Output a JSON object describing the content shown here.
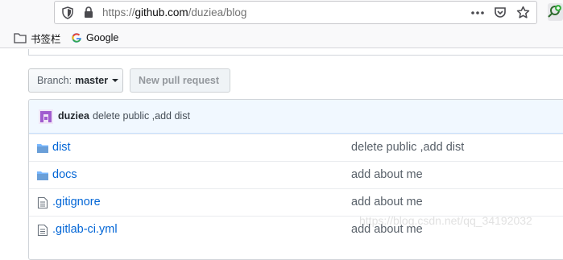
{
  "browser": {
    "url_scheme": "https://",
    "url_host": "github.com",
    "url_path": "/duziea/blog",
    "bookmarks": [
      {
        "label": "书签栏",
        "icon": "folder-icon"
      },
      {
        "label": "Google",
        "icon": "google-icon"
      }
    ]
  },
  "repo": {
    "branch_prefix": "Branch:",
    "branch_name": "master",
    "new_pr_label": "New pull request",
    "latest_commit": {
      "author": "duziea",
      "message": "delete public ,add dist"
    },
    "files": [
      {
        "name": "dist",
        "type": "folder",
        "message": "delete public ,add dist"
      },
      {
        "name": "docs",
        "type": "folder",
        "message": "add about me"
      },
      {
        "name": ".gitignore",
        "type": "file",
        "message": "add about me"
      },
      {
        "name": ".gitlab-ci.yml",
        "type": "file",
        "message": "add about me"
      }
    ]
  },
  "watermark": "https://blog.csdn.net/qq_34192032",
  "colors": {
    "link": "#0366d6",
    "commit_bar_bg": "#f1f8ff",
    "folder_icon": "#79b8ff",
    "avatar": "#a05ccf"
  }
}
